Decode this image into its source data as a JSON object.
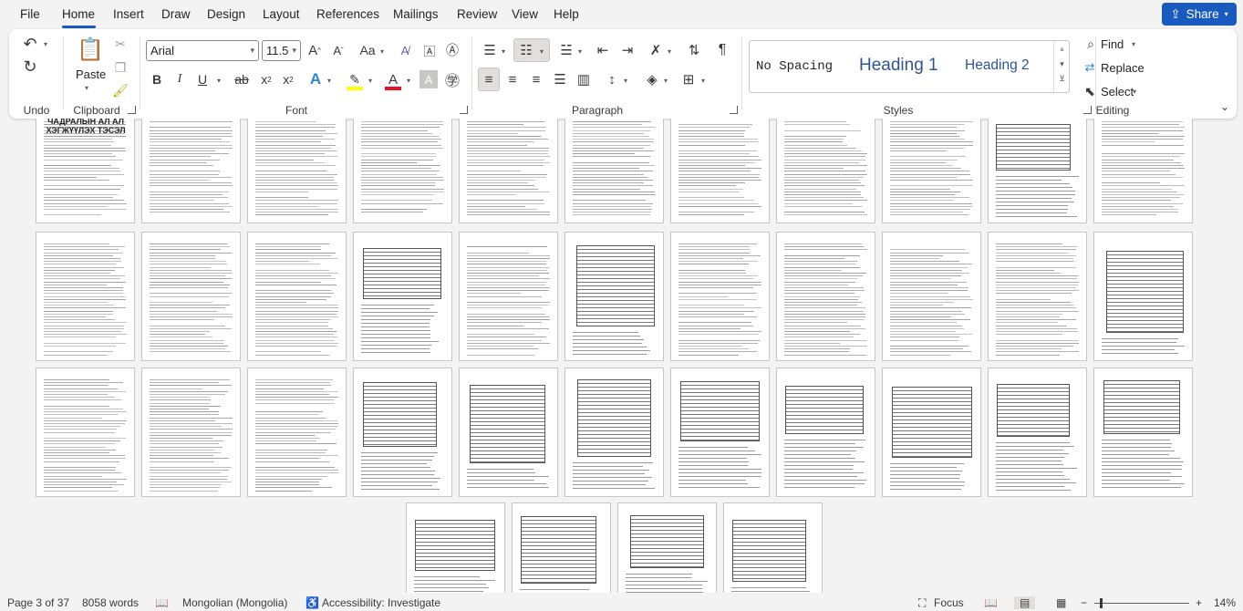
{
  "menu": {
    "tabs": [
      "File",
      "Home",
      "Insert",
      "Draw",
      "Design",
      "Layout",
      "References",
      "Mailings",
      "Review",
      "View",
      "Help"
    ],
    "active_tab": "Home",
    "share_label": "Share"
  },
  "ribbon": {
    "groups": {
      "undo": "Undo",
      "clipboard": "Clipboard",
      "font": "Font",
      "paragraph": "Paragraph",
      "styles": "Styles",
      "editing": "Editing"
    },
    "paste_label": "Paste",
    "font_name": "Arial",
    "font_size": "11.5",
    "styles": [
      "No Spacing",
      "Heading 1",
      "Heading 2"
    ],
    "find_label": "Find",
    "replace_label": "Replace",
    "select_label": "Select"
  },
  "document": {
    "first_page_title_line1": "ЧАДРАЛЫН АЛ АЛ",
    "first_page_title_line2": "ХЭГЖҮҮЛЭХ ТЭСЭЛ"
  },
  "status": {
    "page": "Page 3 of 37",
    "words": "8058 words",
    "language": "Mongolian (Mongolia)",
    "accessibility": "Accessibility: Investigate",
    "focus": "Focus",
    "zoom": "14%"
  },
  "colors": {
    "accent": "#185abd",
    "heading_blue": "#2f5496"
  }
}
